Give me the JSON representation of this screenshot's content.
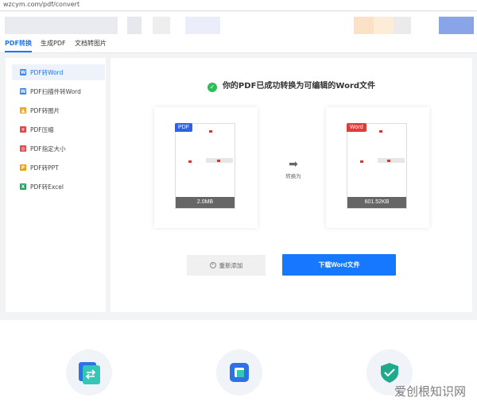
{
  "browser": {
    "url": "wzcym.com/pdf/convert"
  },
  "colors": {
    "accent": "#1677ff",
    "success": "#2ebd59",
    "pdf_badge": "#2d62e0",
    "word_badge": "#e03c3c"
  },
  "topnav": {
    "tabs": [
      {
        "label": "PDF转换",
        "active": true
      },
      {
        "label": "生成PDF",
        "active": false
      },
      {
        "label": "文档转图片",
        "active": false
      }
    ]
  },
  "sidebar": {
    "items": [
      {
        "label": "PDF转Word",
        "icon": "word-icon",
        "icon_color": "#3b82f6",
        "active": true
      },
      {
        "label": "PDF扫描件转Word",
        "icon": "word-icon",
        "icon_color": "#3b82f6",
        "active": false
      },
      {
        "label": "PDF转图片",
        "icon": "image-icon",
        "icon_color": "#f5a623",
        "active": false
      },
      {
        "label": "PDF压缩",
        "icon": "compress-icon",
        "icon_color": "#e5484d",
        "active": false
      },
      {
        "label": "PDF指定大小",
        "icon": "resize-icon",
        "icon_color": "#e5484d",
        "active": false
      },
      {
        "label": "PDF转PPT",
        "icon": "ppt-icon",
        "icon_color": "#f59e0b",
        "active": false
      },
      {
        "label": "PDF转Excel",
        "icon": "excel-icon",
        "icon_color": "#22a55a",
        "active": false
      }
    ]
  },
  "result": {
    "message": "你的PDF已成功转换为可编辑的Word文件",
    "source": {
      "badge": "PDF",
      "size": "2.0MB"
    },
    "target": {
      "badge": "Word",
      "size": "601.52KB"
    },
    "arrow_label": "转换为",
    "readd_label": "重新添加",
    "download_label": "下载Word文件"
  },
  "watermark": "爱创根知识网"
}
